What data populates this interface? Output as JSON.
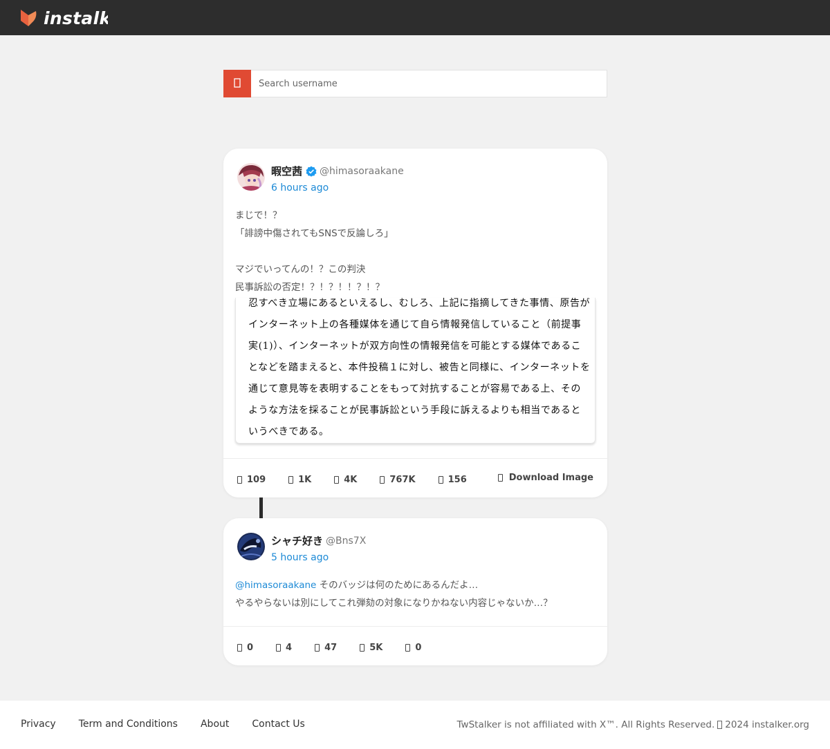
{
  "header": {
    "brand": "instalk"
  },
  "search": {
    "placeholder": "Search username"
  },
  "posts": [
    {
      "display_name": "暇空茜",
      "handle": "@himasoraakane",
      "time": "6 hours ago",
      "lines": [
        "まじで！？",
        "「誹謗中傷されてもSNSで反論しろ」",
        "",
        "マジでいってんの！？この判決",
        "民事訴訟の否定！？！？！！？！？"
      ],
      "media_lines": [
        "忍すべき立場にあるといえるし、むしろ、上記に指摘してきた事情、原告が",
        "インターネット上の各種媒体を通じて自ら情報発信していること（前提事",
        "実(1)）、インターネットが双方向性の情報発信を可能とする媒体であるこ",
        "となどを踏まえると、本件投稿１に対し、被告と同様に、インターネットを",
        "通じて意見等を表明することをもって対抗することが容易である上、その",
        "ような方法を採ることが民事訴訟という手段に訴えるよりも相当であると",
        "いうべきである。"
      ],
      "stats": [
        "109",
        "1K",
        "4K",
        "767K",
        "156"
      ],
      "download_label": "Download Image"
    },
    {
      "display_name": "シャチ好き",
      "handle": "@Bns7X",
      "time": "5 hours ago",
      "mention": "@himasoraakane",
      "line1_rest": " そのバッジは何のためにあるんだよ…",
      "line2": "やるやらないは別にしてこれ弾劾の対象になりかねない内容じゃないか…？",
      "stats": [
        "0",
        "4",
        "47",
        "5K",
        "0"
      ]
    }
  ],
  "footer": {
    "links": [
      "Privacy",
      "Term and Conditions",
      "About",
      "Contact Us"
    ],
    "copy_prefix": "TwStalker is not affiliated with X™. All Rights Reserved.",
    "copy_suffix": "2024 instalker.org"
  },
  "colors": {
    "accent": "#e04a33",
    "link": "#1d8ad6",
    "topbar": "#2d2d2d"
  }
}
